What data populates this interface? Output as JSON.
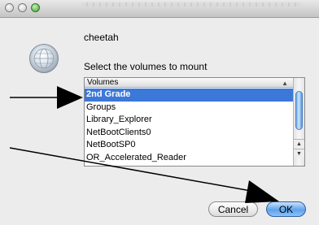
{
  "dialog": {
    "server_name": "cheetah",
    "prompt": "Select the volumes to mount"
  },
  "volumes": {
    "header": "Volumes",
    "items": [
      "2nd Grade",
      "Groups",
      "Library_Explorer",
      "NetBootClients0",
      "NetBootSP0",
      "OR_Accelerated_Reader"
    ],
    "selected_index": 0
  },
  "buttons": {
    "cancel": "Cancel",
    "ok": "OK"
  },
  "icons": {
    "server": "server-globe-icon",
    "sort": "sort-ascending-icon"
  },
  "colors": {
    "selection": "#3c78d8",
    "default_button": "#5ea2ea",
    "annotation": "#000000"
  }
}
